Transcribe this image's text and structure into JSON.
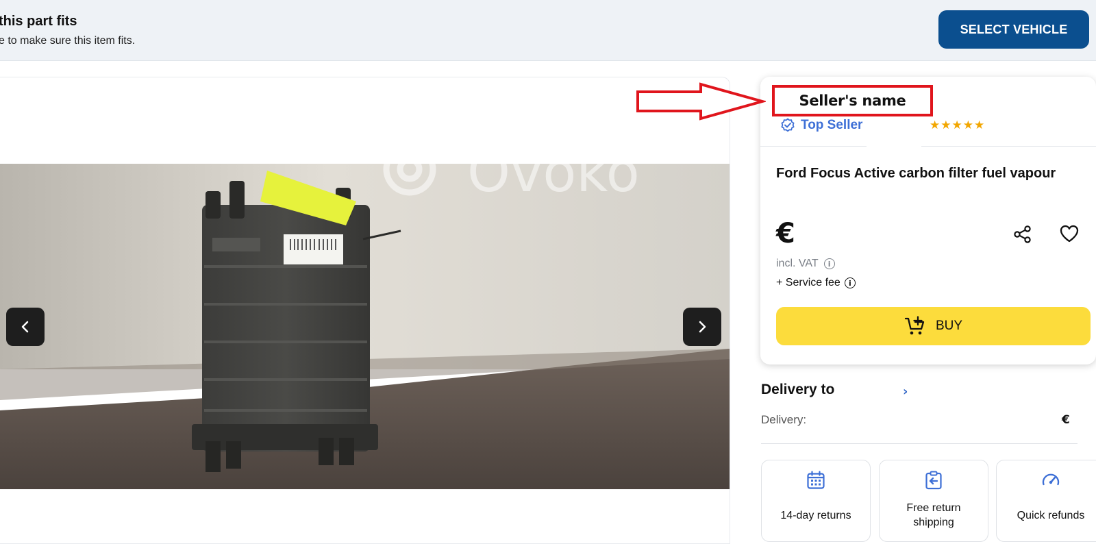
{
  "fit_banner": {
    "title": "this part fits",
    "subtitle": "e to make sure this item fits.",
    "select_button_label": "SELECT VEHICLE",
    "accent_color": "#0b4f8f"
  },
  "gallery": {
    "image_description_icon": "product-photo",
    "watermark_text": "Ovoko",
    "prev_icon": "chevron-left-icon",
    "next_icon": "chevron-right-icon"
  },
  "seller": {
    "name_annotation": "Seller's name",
    "badge_label": "Top Seller",
    "badge_color": "#3d6fd6",
    "rating_stars": "★★★★★",
    "rating_value": 5,
    "annotation_color": "#e0151c"
  },
  "product": {
    "title": "Ford Focus Active carbon filter fuel vapour",
    "price": "€",
    "vat_label": "incl. VAT",
    "fee_label": "+ Service fee",
    "info_glyph": "i",
    "buy_label": "BUY",
    "buy_color": "#fcdc3c"
  },
  "delivery": {
    "title": "Delivery to",
    "chevron": "›",
    "label": "Delivery:",
    "value": "€"
  },
  "benefits": [
    {
      "label": "14-day returns",
      "icon": "calendar-icon"
    },
    {
      "label": "Free return shipping",
      "icon": "return-box-icon"
    },
    {
      "label": "Quick refunds",
      "icon": "speedometer-icon"
    }
  ]
}
